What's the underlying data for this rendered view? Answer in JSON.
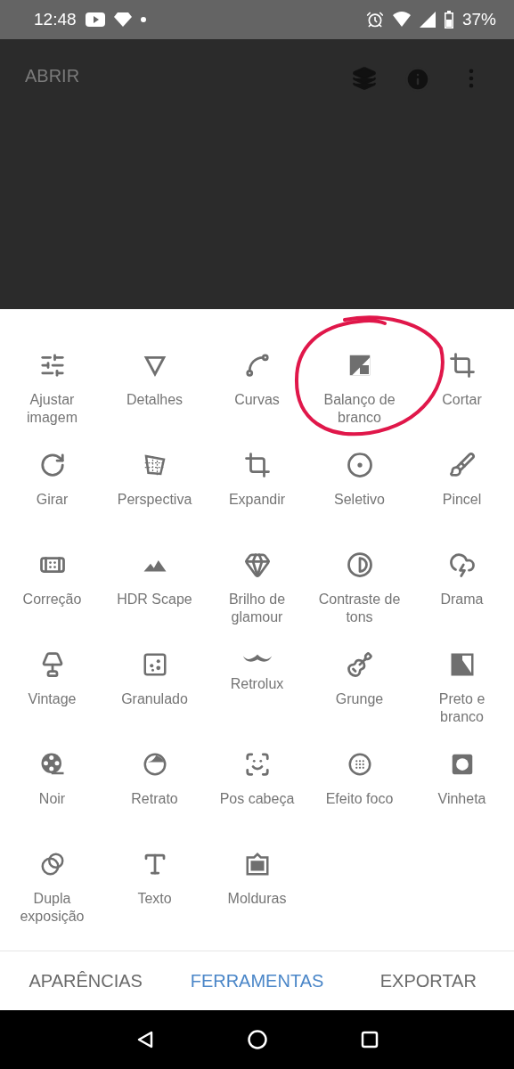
{
  "status_bar": {
    "time": "12:48",
    "battery": "37%"
  },
  "app_bar": {
    "title": "ABRIR"
  },
  "tools": [
    {
      "label": "Ajustar imagem"
    },
    {
      "label": "Detalhes"
    },
    {
      "label": "Curvas"
    },
    {
      "label": "Balanço de branco",
      "circled": true
    },
    {
      "label": "Cortar"
    },
    {
      "label": "Girar"
    },
    {
      "label": "Perspectiva"
    },
    {
      "label": "Expandir"
    },
    {
      "label": "Seletivo"
    },
    {
      "label": "Pincel"
    },
    {
      "label": "Correção"
    },
    {
      "label": "HDR Scape"
    },
    {
      "label": "Brilho de glamour"
    },
    {
      "label": "Contraste de tons"
    },
    {
      "label": "Drama"
    },
    {
      "label": "Vintage"
    },
    {
      "label": "Granulado"
    },
    {
      "label": "Retrolux"
    },
    {
      "label": "Grunge"
    },
    {
      "label": "Preto e branco"
    },
    {
      "label": "Noir"
    },
    {
      "label": "Retrato"
    },
    {
      "label": "Pos cabeça"
    },
    {
      "label": "Efeito foco"
    },
    {
      "label": "Vinheta"
    },
    {
      "label": "Dupla exposição"
    },
    {
      "label": "Texto"
    },
    {
      "label": "Molduras"
    }
  ],
  "bottom_tabs": [
    {
      "label": "APARÊNCIAS",
      "selected": false
    },
    {
      "label": "FERRAMENTAS",
      "selected": true
    },
    {
      "label": "EXPORTAR",
      "selected": false
    }
  ]
}
